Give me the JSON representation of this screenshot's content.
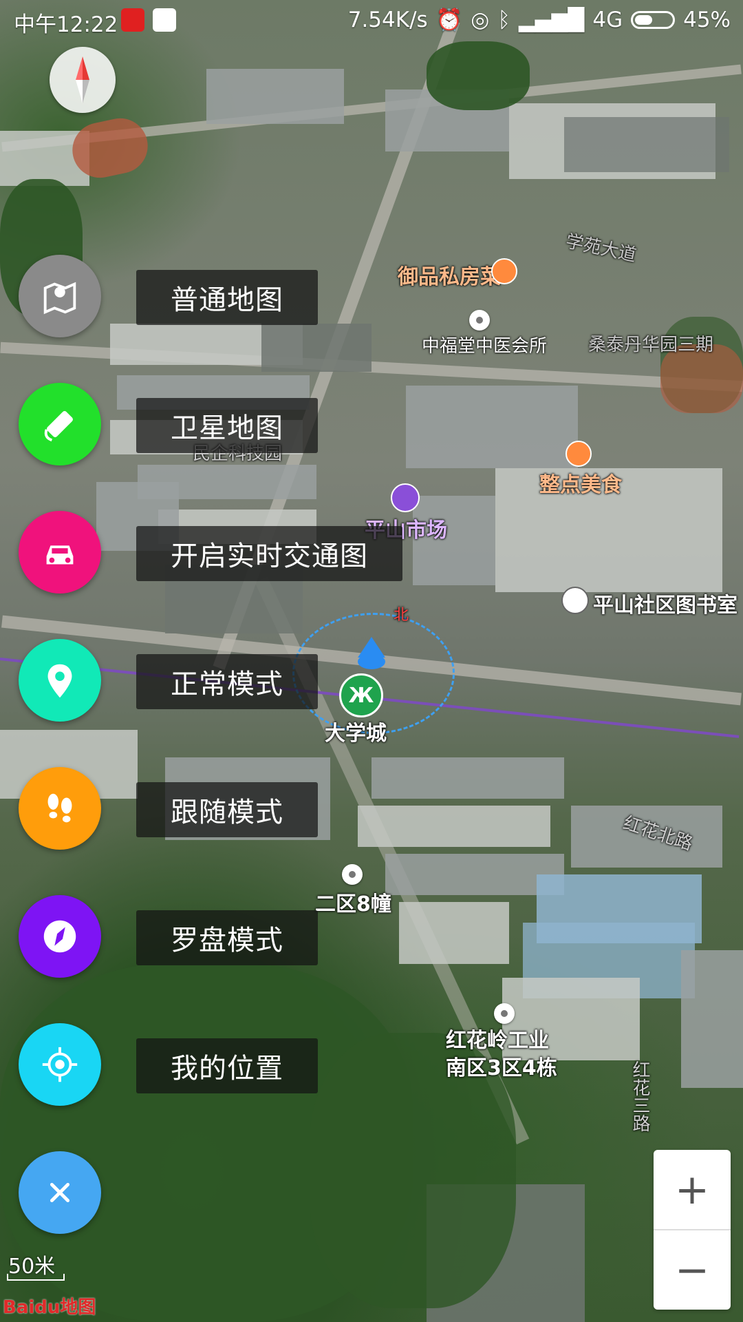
{
  "status_bar": {
    "time": "中午12:22",
    "net_speed": "7.54K/s",
    "network": "4G",
    "battery": "45%"
  },
  "menu": [
    {
      "label": "普通地图",
      "icon": "map-icon",
      "color": "#8a8a8a"
    },
    {
      "label": "卫星地图",
      "icon": "satellite-icon",
      "color": "#22e02b"
    },
    {
      "label": "开启实时交通图",
      "icon": "car-icon",
      "color": "#f0127c"
    },
    {
      "label": "正常模式",
      "icon": "location-pin-icon",
      "color": "#11e9b7"
    },
    {
      "label": "跟随模式",
      "icon": "footprints-icon",
      "color": "#ff9d0b"
    },
    {
      "label": "罗盘模式",
      "icon": "compass-icon",
      "color": "#7e14f4"
    },
    {
      "label": "我的位置",
      "icon": "crosshair-icon",
      "color": "#19d6f4"
    },
    {
      "label": "",
      "icon": "close-icon",
      "color": "#45a7f2"
    }
  ],
  "map_labels": {
    "restaurant1": "御品私房菜",
    "clinic": "中福堂中医会所",
    "estate": "桑泰丹华园三期",
    "park": "民企科技园",
    "food": "整点美食",
    "market": "平山市场",
    "library": "平山社区图书室",
    "road1": "学苑大道",
    "road2": "红花北路",
    "road3": "红花三路",
    "station": "大学城",
    "building8": "二区8幢",
    "industrial": "红花岭工业\n南区3区4栋",
    "north": "北"
  },
  "zoom": {
    "plus": "+",
    "minus": "−"
  },
  "scale": "50米",
  "logo": "Baidu地图"
}
